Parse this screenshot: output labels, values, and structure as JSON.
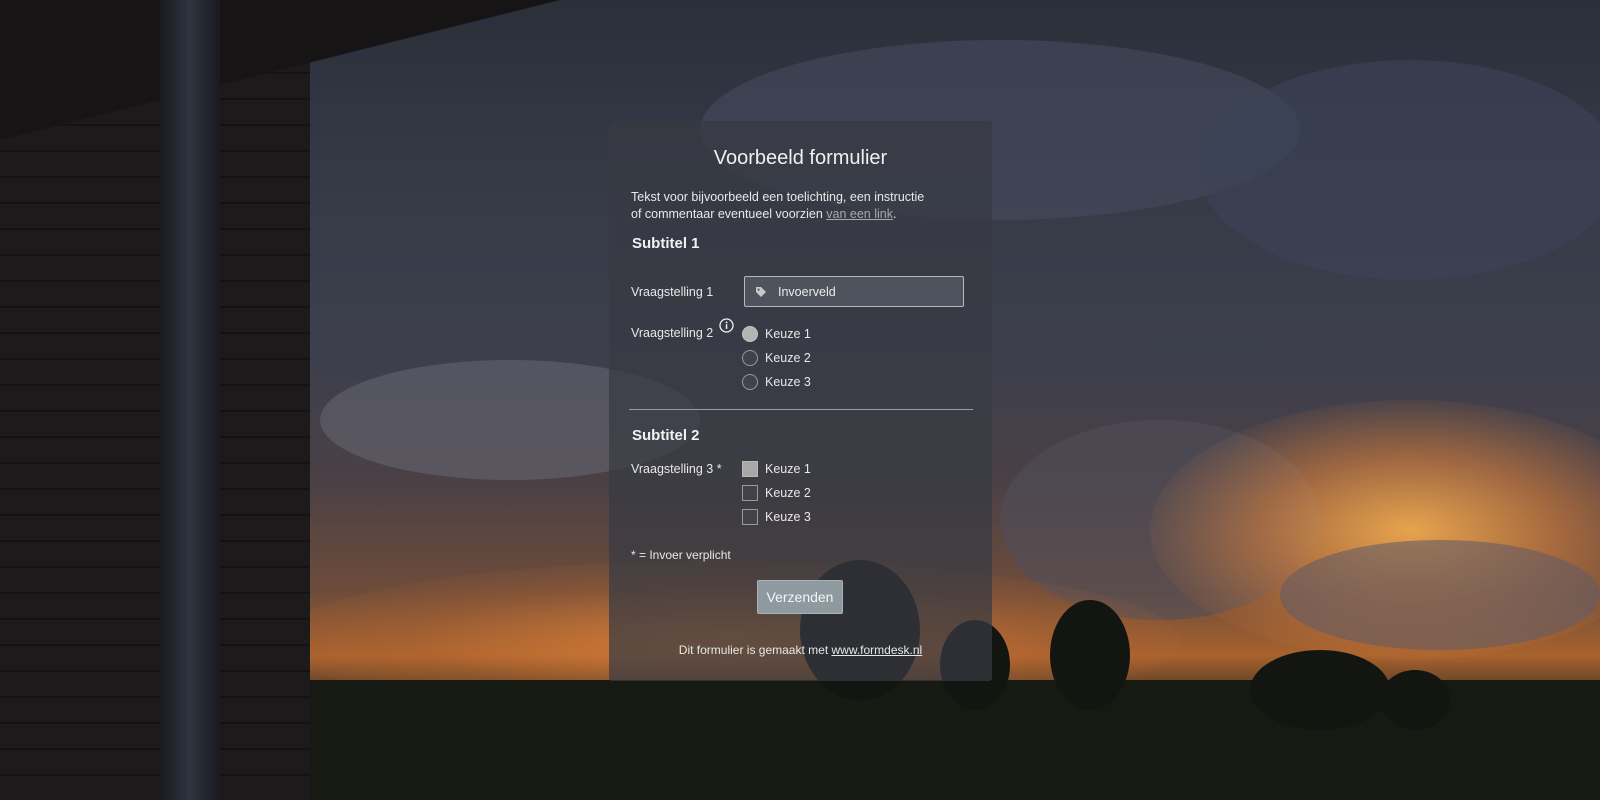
{
  "form": {
    "title": "Voorbeeld formulier",
    "intro_line1": "Tekst voor bijvoorbeeld een toelichting, een instructie",
    "intro_line2_prefix": "of commentaar eventueel voorzien ",
    "intro_link": "van een link",
    "intro_suffix": ".",
    "section1": {
      "subtitle": "Subtitel 1",
      "q1_label": "Vraagstelling 1",
      "q1_input_placeholder": "Invoerveld",
      "q1_input_icon": "tag-icon",
      "q2_label": "Vraagstelling 2",
      "q2_info_icon": "info-icon",
      "q2_options": [
        "Keuze 1",
        "Keuze 2",
        "Keuze 3"
      ],
      "q2_selected": "Keuze 1"
    },
    "section2": {
      "subtitle": "Subtitel 2",
      "q3_label": "Vraagstelling 3 *",
      "q3_options": [
        "Keuze 1",
        "Keuze 2",
        "Keuze 3"
      ],
      "q3_checked": [
        "Keuze 1"
      ]
    },
    "required_note": "* = Invoer verplicht",
    "submit_label": "Verzenden",
    "footer_prefix": "Dit formulier is gemaakt met ",
    "footer_link": "www.formdesk.nl"
  },
  "colors": {
    "panel_bg": "#373a42",
    "text": "#e6e6e6",
    "submit_bg": "#8e9aa0",
    "link_muted": "#a8a8a8"
  }
}
